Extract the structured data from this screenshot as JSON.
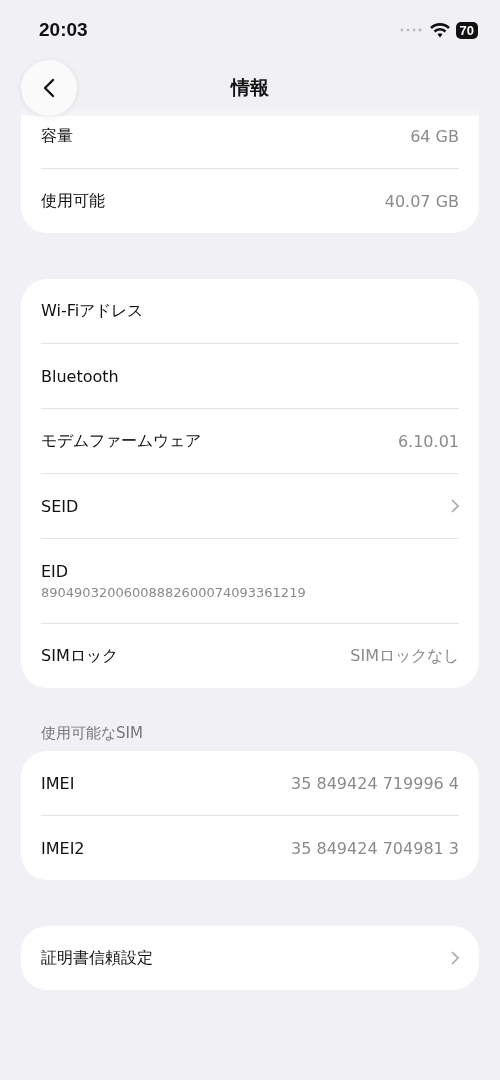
{
  "status_bar": {
    "time": "20:03",
    "battery": "70"
  },
  "nav": {
    "title": "情報"
  },
  "groups": [
    {
      "rows": [
        {
          "label": "容量",
          "value": "64 GB"
        },
        {
          "label": "使用可能",
          "value": "40.07 GB"
        }
      ]
    },
    {
      "rows": [
        {
          "label": "Wi-Fiアドレス"
        },
        {
          "label": "Bluetooth"
        },
        {
          "label": "モデムファームウェア",
          "value": "6.10.01"
        },
        {
          "label": "SEID",
          "chevron": true
        },
        {
          "label": "EID",
          "detail": "89049032006008882600074093361219"
        },
        {
          "label": "SIMロック",
          "value": "SIMロックなし"
        }
      ]
    },
    {
      "header": "使用可能なSIM",
      "rows": [
        {
          "label": "IMEI",
          "value": "35 849424 719996 4"
        },
        {
          "label": "IMEI2",
          "value": "35 849424 704981 3"
        }
      ]
    },
    {
      "rows": [
        {
          "label": "証明書信頼設定",
          "chevron": true
        }
      ]
    }
  ]
}
